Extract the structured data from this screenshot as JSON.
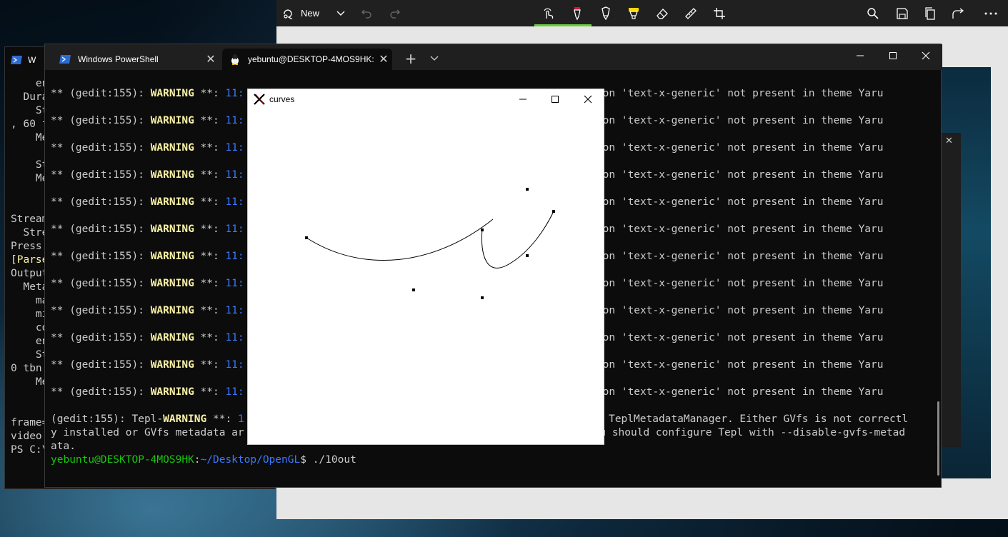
{
  "sketch": {
    "new_label": "New",
    "toolbar_icons": [
      "touch-writing-icon",
      "ballpoint-pen-icon",
      "pencil-icon",
      "highlighter-icon",
      "eraser-icon",
      "ruler-icon",
      "crop-icon",
      "zoom-icon",
      "save-icon",
      "copy-icon",
      "share-icon",
      "more-icon"
    ],
    "pen_accent": "#6ccb3f"
  },
  "background_ps": {
    "tab_label": "W",
    "lines": [
      "    en",
      "  Dura",
      "    St",
      ", 60 f",
      "    Me",
      "",
      "    St",
      "    Me",
      "",
      "",
      "Stream",
      "  Stre",
      "Press ",
      "[Parse",
      "Output",
      "  Meta",
      "    ma",
      "    mi",
      "    co",
      "    en",
      "    St",
      "0 tbn",
      "    Me",
      "",
      "",
      "frame=",
      "video:",
      "PS C:\\"
    ]
  },
  "terminal": {
    "tabs": [
      {
        "label": "Windows PowerShell",
        "icon": "powershell-icon"
      },
      {
        "label": "yebuntu@DESKTOP-4MOS9HK:",
        "icon": "tux-linux-icon"
      }
    ],
    "new_tab_symbol": "+",
    "log": {
      "prefix": "** (gedit:155): ",
      "level": "WARNING",
      "sep": " **: ",
      "ts": "11:",
      "suffix": "on 'text-x-generic' not present in theme Yaru",
      "line_count": 12
    },
    "tepl": {
      "line1_prefix": "(gedit:155): Tepl-",
      "line1_level": "WARNING",
      "line1_sep": " **: ",
      "line1_ts": "1",
      "line1_tail": "o TeplMetadataManager. Either GVfs is not correctl",
      "line2_head": "y installed or GVfs metadata ar",
      "line2_tail": "ou should configure Tepl with --disable-gvfs-metad",
      "line3": "ata."
    },
    "prompt": {
      "user": "yebuntu@DESKTOP-4MOS9HK",
      "colon": ":",
      "path": "~/Desktop/OpenGL",
      "dollar": "$ ",
      "command": "./10out"
    }
  },
  "curves": {
    "title": "curves",
    "app_icon": "x-window-system-icon"
  },
  "colors": {
    "terminal_bg": "#0c0c0c",
    "warning": "#f9f1a5",
    "timestamp": "#3b78ff",
    "prompt_user": "#16c60c",
    "prompt_path": "#3b78ff"
  }
}
